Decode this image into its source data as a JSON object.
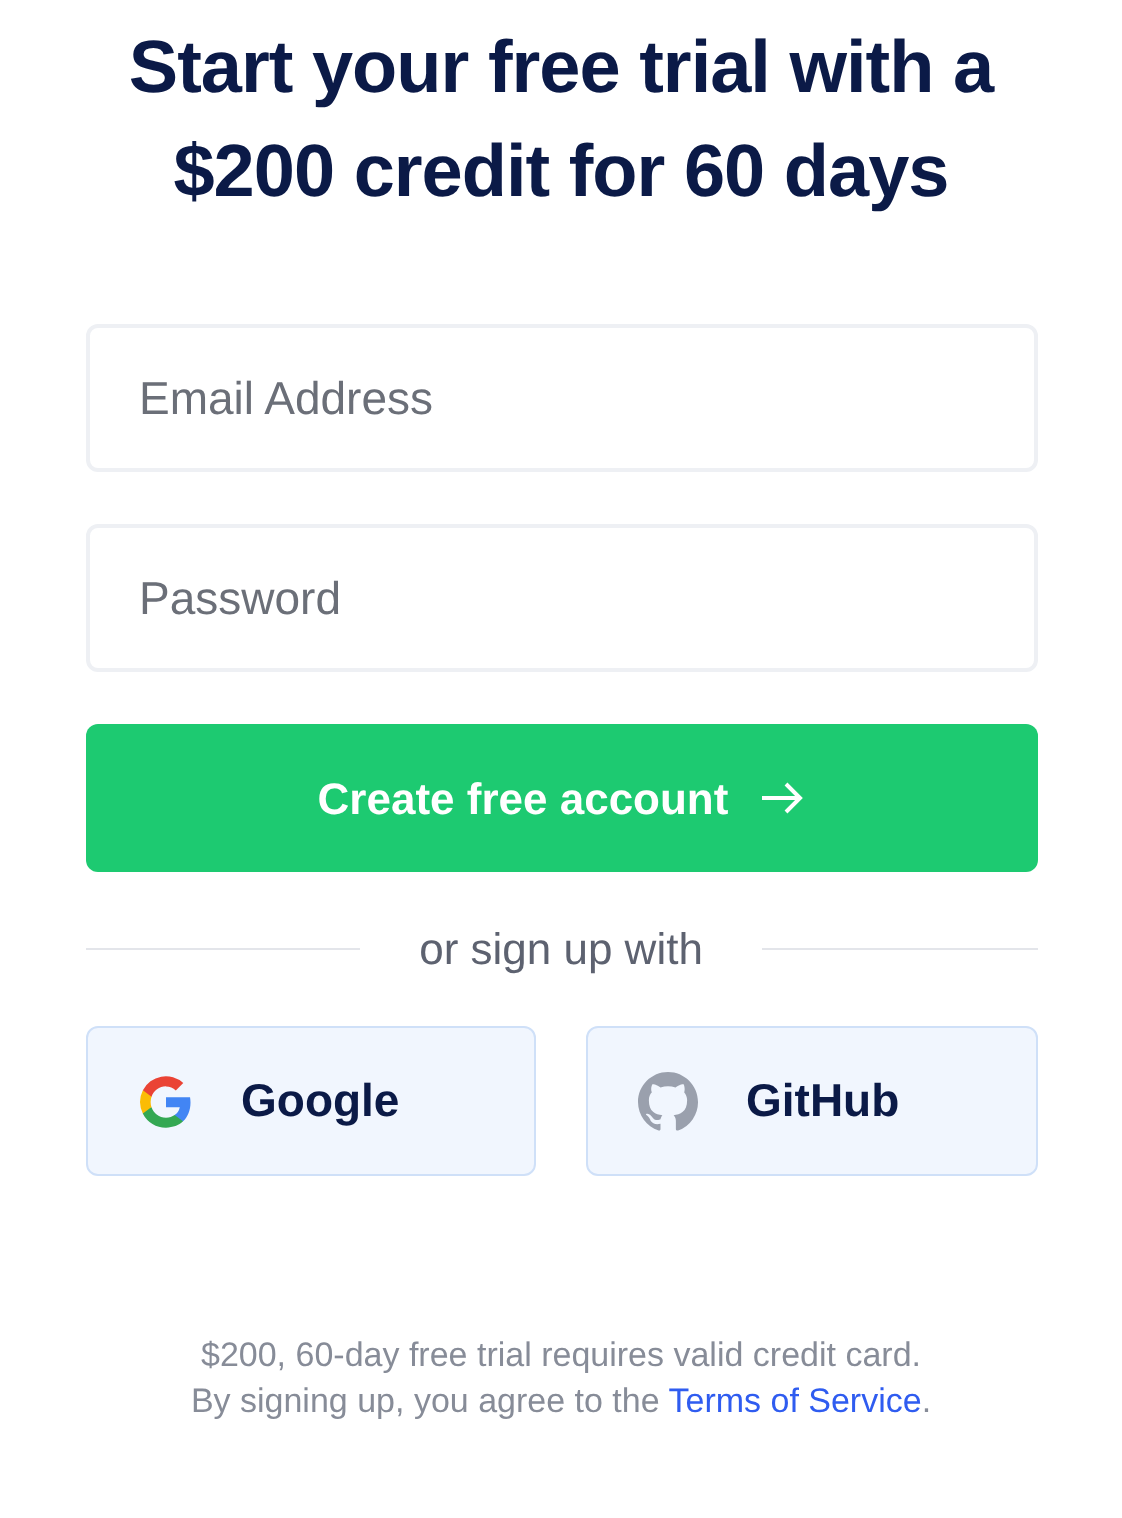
{
  "heading": [
    "Start your free trial with a",
    "$200 credit for 60 days"
  ],
  "fields": [
    {
      "placeholder": "Email Address"
    },
    {
      "placeholder": "Password"
    }
  ],
  "submit_button": {
    "label": "Create free account"
  },
  "divider": {
    "label": "or sign up with"
  },
  "social_buttons": [
    {
      "label": "Google",
      "kind": "google"
    },
    {
      "label": "GitHub",
      "kind": "github"
    }
  ],
  "footer": {
    "line_1": "$200, 60-day free trial requires valid credit card.",
    "line_2": "By signing up, you agree to the ",
    "link": "Terms of Service",
    "line_2_end": "."
  }
}
